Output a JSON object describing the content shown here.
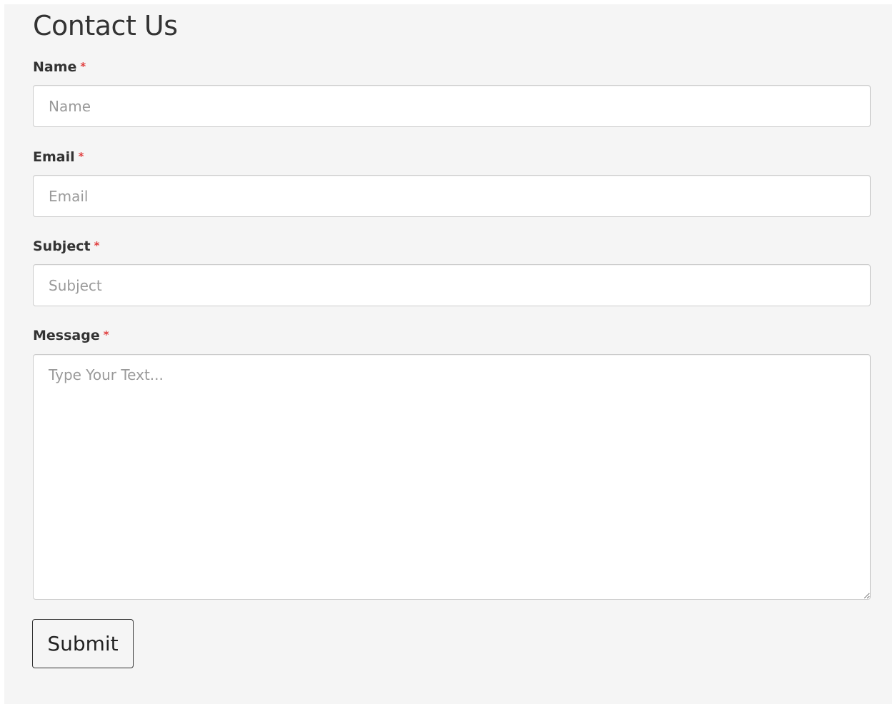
{
  "form": {
    "title": "Contact Us",
    "required_marker": "*",
    "fields": {
      "name": {
        "label": "Name",
        "placeholder": "Name",
        "value": ""
      },
      "email": {
        "label": "Email",
        "placeholder": "Email",
        "value": ""
      },
      "subject": {
        "label": "Subject",
        "placeholder": "Subject",
        "value": ""
      },
      "message": {
        "label": "Message",
        "placeholder": "Type Your Text...",
        "value": ""
      }
    },
    "submit_label": "Submit"
  },
  "colors": {
    "panel_background": "#f5f5f5",
    "required_marker": "#e03e3e",
    "field_border": "#cccccc",
    "text": "#333333"
  }
}
